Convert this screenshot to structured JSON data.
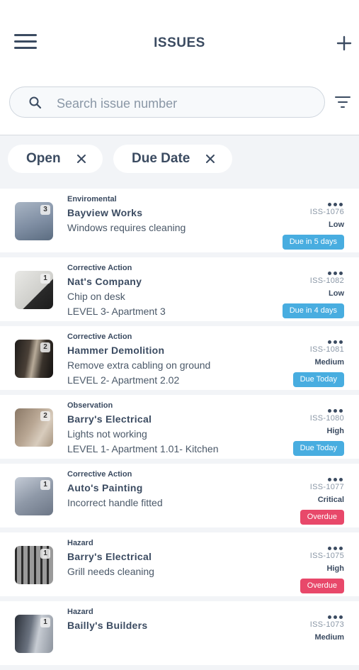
{
  "header": {
    "title": "ISSUES"
  },
  "search": {
    "placeholder": "Search issue number",
    "value": ""
  },
  "filters": [
    {
      "label": "Open"
    },
    {
      "label": "Due Date"
    }
  ],
  "colors": {
    "due_blue": "#48ade0",
    "overdue_red": "#e8486a",
    "text_dark": "#3b4b61"
  },
  "issues": [
    {
      "category": "Enviromental",
      "company": "Bayview Works",
      "description": "Windows requires cleaning",
      "location": "",
      "id": "ISS-1076",
      "priority": "Low",
      "due": "Due in 5 days",
      "due_status": "blue",
      "photo_count": "3"
    },
    {
      "category": "Corrective Action",
      "company": "Nat's Company",
      "description": "Chip on desk",
      "location": "LEVEL 3- Apartment 3",
      "id": "ISS-1082",
      "priority": "Low",
      "due": "Due in 4 days",
      "due_status": "blue",
      "photo_count": "1"
    },
    {
      "category": "Corrective Action",
      "company": "Hammer Demolition",
      "description": "Remove extra cabling on ground",
      "location": "LEVEL 2- Apartment 2.02",
      "id": "ISS-1081",
      "priority": "Medium",
      "due": "Due Today",
      "due_status": "blue",
      "photo_count": "2"
    },
    {
      "category": "Observation",
      "company": "Barry's Electrical",
      "description": "Lights not working",
      "location": "LEVEL 1- Apartment 1.01- Kitchen",
      "id": "ISS-1080",
      "priority": "High",
      "due": "Due Today",
      "due_status": "blue",
      "photo_count": "2"
    },
    {
      "category": "Corrective Action",
      "company": "Auto's Painting",
      "description": "Incorrect handle fitted",
      "location": "",
      "id": "ISS-1077",
      "priority": "Critical",
      "due": "Overdue",
      "due_status": "red",
      "photo_count": "1"
    },
    {
      "category": "Hazard",
      "company": "Barry's Electrical",
      "description": "Grill needs cleaning",
      "location": "",
      "id": "ISS-1075",
      "priority": "High",
      "due": "Overdue",
      "due_status": "red",
      "photo_count": "1"
    },
    {
      "category": "Hazard",
      "company": "Bailly's Builders",
      "description": "",
      "location": "",
      "id": "ISS-1073",
      "priority": "Medium",
      "due": "",
      "due_status": "blue",
      "photo_count": "1"
    }
  ]
}
